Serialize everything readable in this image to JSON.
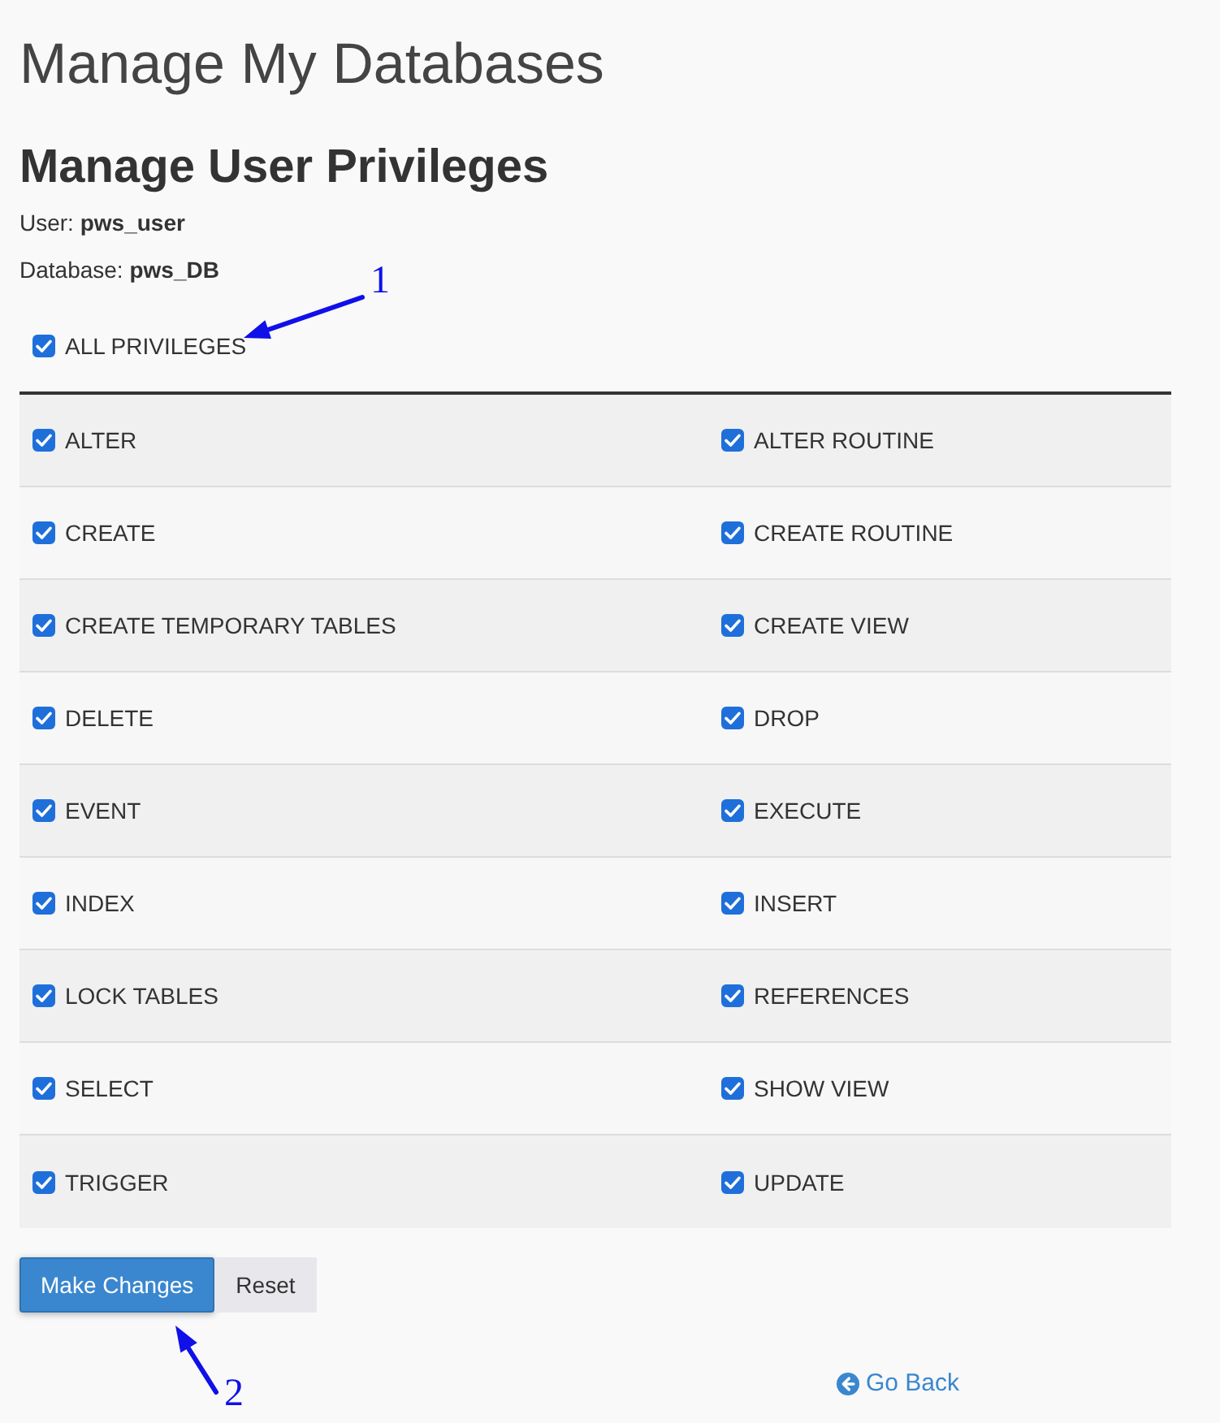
{
  "page": {
    "title": "Manage My Databases",
    "heading": "Manage User Privileges",
    "user": "User: **pws_user**",
    "database": "Database: **pws_DB**"
  },
  "all_privileges": {
    "label": "ALL PRIVILEGES",
    "checked": true
  },
  "privilege_rows": [
    {
      "cells": [
        {
          "label": "ALTER",
          "checked": true
        },
        {
          "label": "ALTER ROUTINE",
          "checked": true
        }
      ]
    },
    {
      "cells": [
        {
          "label": "CREATE",
          "checked": true
        },
        {
          "label": "CREATE ROUTINE",
          "checked": true
        }
      ]
    },
    {
      "cells": [
        {
          "label": "CREATE TEMPORARY TABLES",
          "checked": true
        },
        {
          "label": "CREATE VIEW",
          "checked": true
        }
      ]
    },
    {
      "cells": [
        {
          "label": "DELETE",
          "checked": true
        },
        {
          "label": "DROP",
          "checked": true
        }
      ]
    },
    {
      "cells": [
        {
          "label": "EVENT",
          "checked": true
        },
        {
          "label": "EXECUTE",
          "checked": true
        }
      ]
    },
    {
      "cells": [
        {
          "label": "INDEX",
          "checked": true
        },
        {
          "label": "INSERT",
          "checked": true
        }
      ]
    },
    {
      "cells": [
        {
          "label": "LOCK TABLES",
          "checked": true
        },
        {
          "label": "REFERENCES",
          "checked": true
        }
      ]
    },
    {
      "cells": [
        {
          "label": "SELECT",
          "checked": true
        },
        {
          "label": "SHOW VIEW",
          "checked": true
        }
      ]
    },
    {
      "cells": [
        {
          "label": "TRIGGER",
          "checked": true
        },
        {
          "label": "UPDATE",
          "checked": true
        }
      ]
    }
  ],
  "buttons": [
    {
      "label": "Make Changes",
      "kind": "primary"
    },
    {
      "label": "Reset",
      "kind": "secondary"
    }
  ],
  "go_back": {
    "label": "Go Back"
  },
  "annotations": [
    {
      "label": "1"
    },
    {
      "label": "2"
    }
  ]
}
